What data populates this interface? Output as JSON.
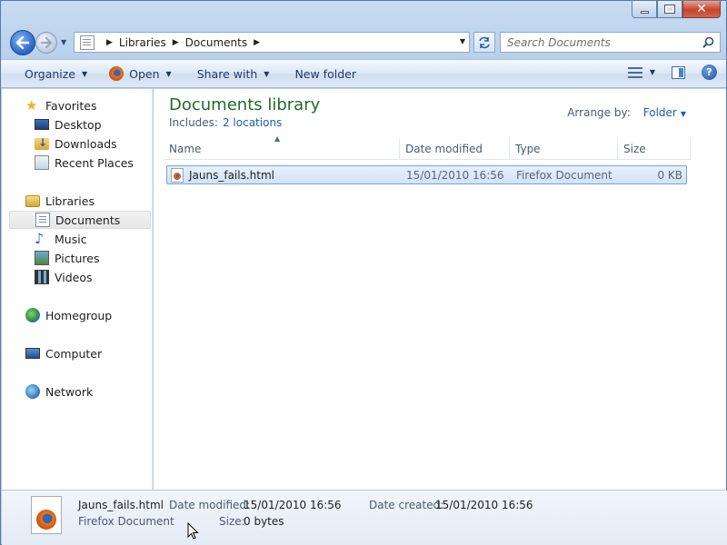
{
  "window": {
    "caption_buttons": {
      "minimize_icon": "minimize-icon",
      "maximize_icon": "maximize-icon",
      "close_glyph": "✕"
    }
  },
  "nav": {
    "breadcrumb": [
      "Libraries",
      "Documents"
    ],
    "search_placeholder": "Search Documents"
  },
  "toolbar": {
    "organize": "Organize",
    "open": "Open",
    "share_with": "Share with",
    "new_folder": "New folder"
  },
  "sidebar": {
    "favorites": {
      "label": "Favorites",
      "items": [
        {
          "label": "Desktop",
          "icon": "desktop-icon"
        },
        {
          "label": "Downloads",
          "icon": "downloads-icon"
        },
        {
          "label": "Recent Places",
          "icon": "recent-places-icon"
        }
      ]
    },
    "libraries": {
      "label": "Libraries",
      "items": [
        {
          "label": "Documents",
          "icon": "documents-icon",
          "selected": true
        },
        {
          "label": "Music",
          "icon": "music-icon"
        },
        {
          "label": "Pictures",
          "icon": "pictures-icon"
        },
        {
          "label": "Videos",
          "icon": "videos-icon"
        }
      ]
    },
    "homegroup": "Homegroup",
    "computer": "Computer",
    "network": "Network"
  },
  "main": {
    "title": "Documents library",
    "includes_label": "Includes:",
    "includes_link": "2 locations",
    "arrange_label": "Arrange by:",
    "arrange_value": "Folder",
    "columns": [
      "Name",
      "Date modified",
      "Type",
      "Size"
    ],
    "files": [
      {
        "name": "Jauns_fails.html",
        "date_modified": "15/01/2010 16:56",
        "type": "Firefox Document",
        "size": "0 KB",
        "selected": true
      }
    ]
  },
  "details": {
    "file_name": "Jauns_fails.html",
    "file_type": "Firefox Document",
    "date_modified_label": "Date modified:",
    "date_modified": "15/01/2010 16:56",
    "date_created_label": "Date created:",
    "date_created": "15/01/2010 16:56",
    "size_label": "Size:",
    "size": "0 bytes"
  },
  "colors": {
    "title_green": "#1e6b2e",
    "link_blue": "#1a5fb4",
    "selection_bg": "#cfe4f8"
  }
}
